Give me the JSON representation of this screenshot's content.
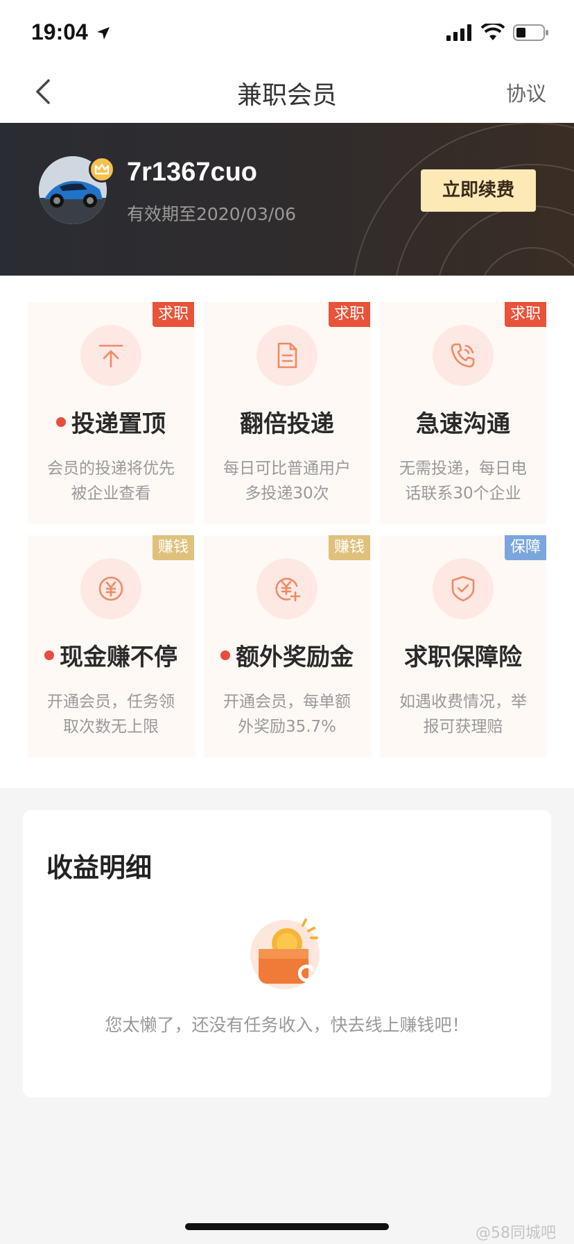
{
  "status": {
    "time": "19:04"
  },
  "nav": {
    "title": "兼职会员",
    "right_label": "协议"
  },
  "member": {
    "username": "7r1367cuo",
    "expiry": "有效期至2020/03/06",
    "renew_label": "立即续费"
  },
  "benefits": [
    {
      "tag": "求职",
      "tag_color": "#e8533a",
      "icon": "arrow-up-top-icon",
      "title": "投递置顶",
      "dot": true,
      "desc_line1": "会员的投递将优先",
      "desc_line2": "被企业查看"
    },
    {
      "tag": "求职",
      "tag_color": "#e8533a",
      "icon": "document-icon",
      "title": "翻倍投递",
      "dot": false,
      "desc_line1": "每日可比普通用户",
      "desc_line2": "多投递30次"
    },
    {
      "tag": "求职",
      "tag_color": "#e8533a",
      "icon": "phone-icon",
      "title": "急速沟通",
      "dot": false,
      "desc_line1": "无需投递，每日电",
      "desc_line2": "话联系30个企业"
    },
    {
      "tag": "赚钱",
      "tag_color": "#dfc17d",
      "icon": "yuan-coin-icon",
      "title": "现金赚不停",
      "dot": true,
      "desc_line1": "开通会员，任务领",
      "desc_line2": "取次数无上限"
    },
    {
      "tag": "赚钱",
      "tag_color": "#dfc17d",
      "icon": "yuan-plus-icon",
      "title": "额外奖励金",
      "dot": true,
      "desc_line1": "开通会员，每单额",
      "desc_line2": "外奖励35.7%"
    },
    {
      "tag": "保障",
      "tag_color": "#7aa6dc",
      "icon": "shield-check-icon",
      "title": "求职保障险",
      "dot": false,
      "desc_line1": "如遇收费情况，举",
      "desc_line2": "报可获理赔"
    }
  ],
  "income": {
    "title": "收益明细",
    "empty_text": "您太懒了，还没有任务收入，快去线上赚钱吧！"
  },
  "watermark": "@58同城吧",
  "colors": {
    "accent": "#e8533a",
    "gold_button": "#fde9b6",
    "banner_dark": "#2a2c33"
  }
}
